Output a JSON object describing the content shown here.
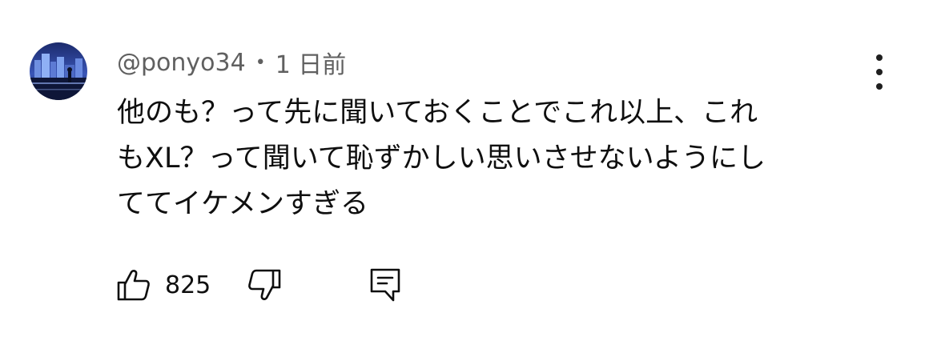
{
  "comment": {
    "author": "@ponyo34",
    "separator": "•",
    "time": "1 日前",
    "text_lines": [
      "他のも？って先に聞いておくことでこれ以上、これ",
      "もXL？って聞いて恥ずかしい思いさせないようにし",
      "ててイケメンすぎる"
    ],
    "like_count": "825",
    "icons": {
      "avatar": "night-city-avatar",
      "like": "thumbs-up-icon",
      "dislike": "thumbs-down-icon",
      "reply": "reply-comment-icon",
      "menu": "more-vertical-icon"
    },
    "colors": {
      "text": "#0f0f0f",
      "meta": "#606060"
    }
  }
}
